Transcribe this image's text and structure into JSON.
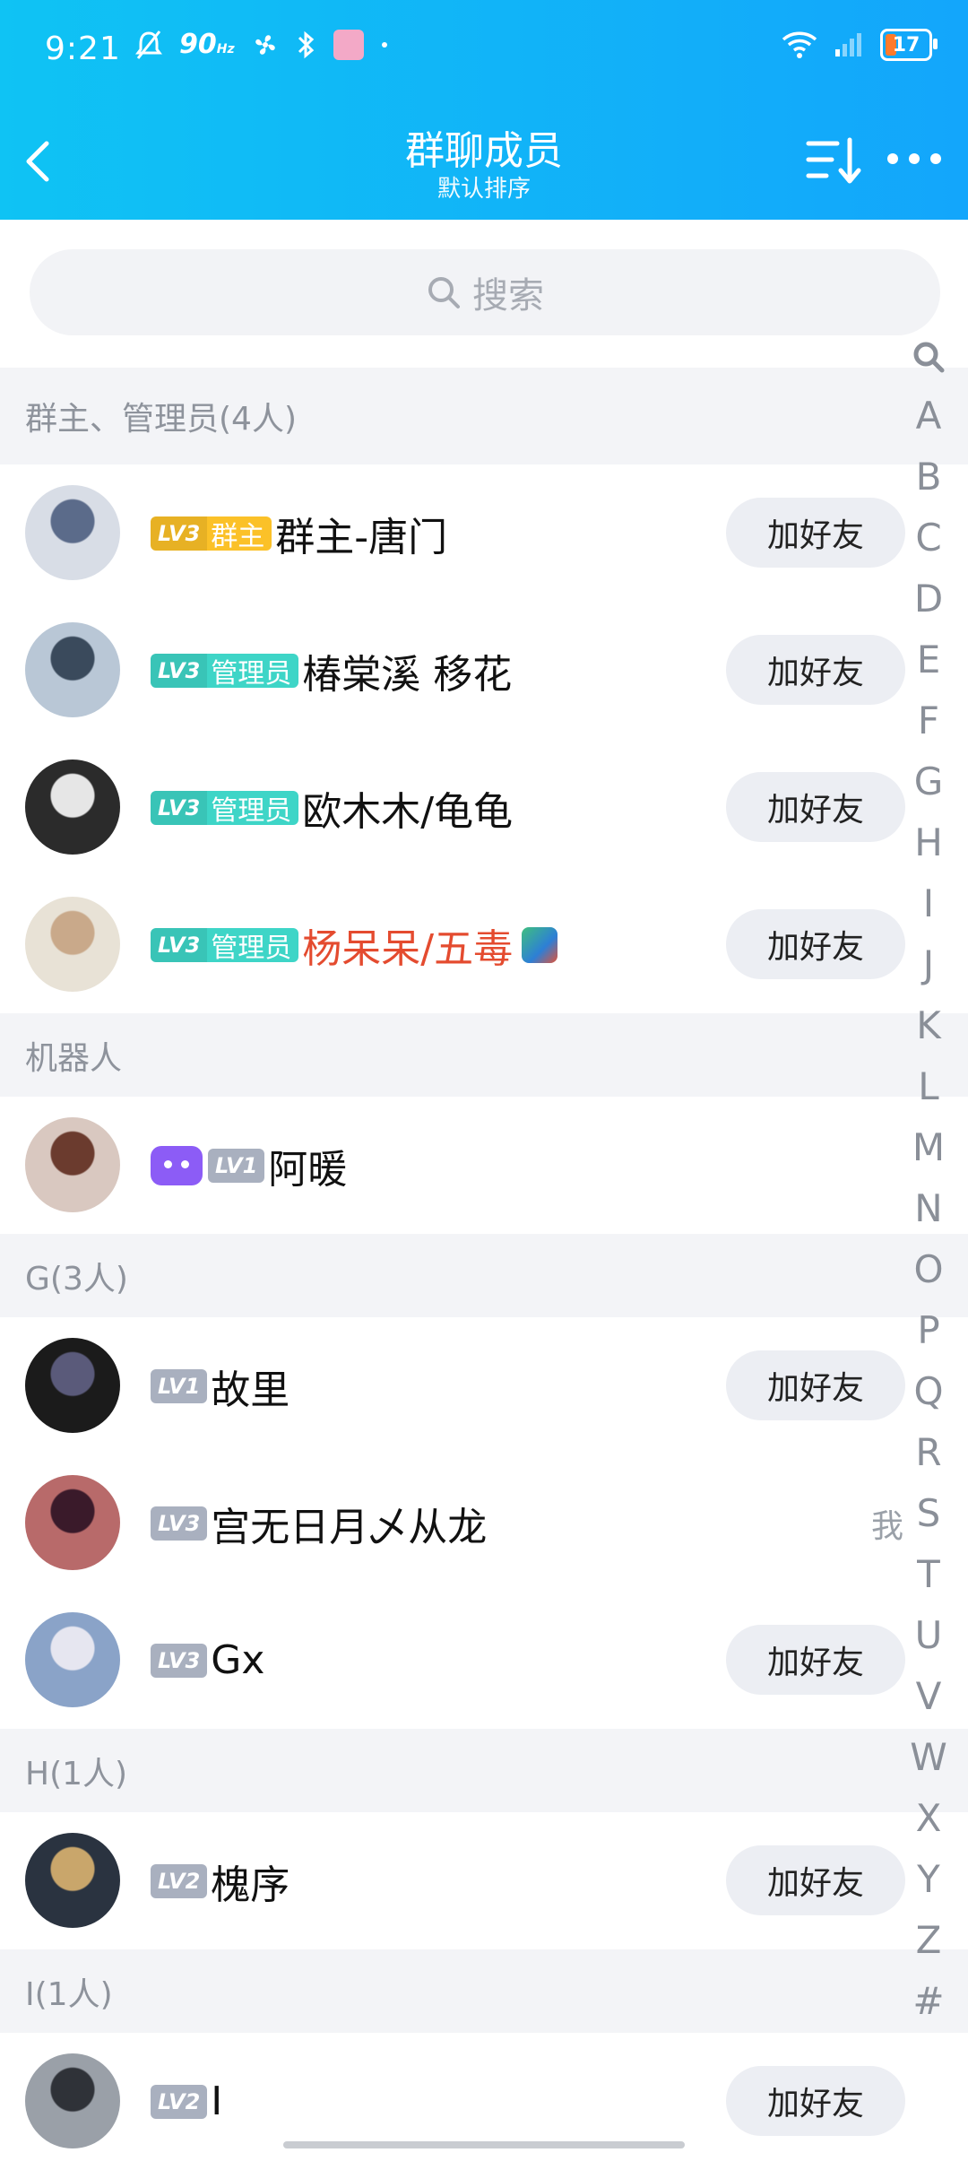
{
  "status_bar": {
    "time": "9:21",
    "refresh_rate": "90",
    "refresh_unit": "Hz",
    "battery": "17"
  },
  "header": {
    "title": "群聊成员",
    "subtitle": "默认排序"
  },
  "search": {
    "placeholder": "搜索"
  },
  "add_friend_label": "加好友",
  "me_label": "我",
  "sections": [
    {
      "title": "群主、管理员(4人)",
      "members": [
        {
          "level": "LV3",
          "role": "群主",
          "name": "群主-唐门",
          "badge_color": "#fbc128",
          "has_add": true
        },
        {
          "level": "LV3",
          "role": "管理员",
          "name": "椿棠溪 移花",
          "badge_color": "#3ed5c7",
          "has_add": true
        },
        {
          "level": "LV3",
          "role": "管理员",
          "name": "欧木木/龟龟",
          "badge_color": "#3ed5c7",
          "has_add": true
        },
        {
          "level": "LV3",
          "role": "管理员",
          "name": "杨呆呆/五毒",
          "badge_color": "#3ed5c7",
          "name_color": "#e44b2f",
          "has_add": true
        }
      ]
    },
    {
      "title": "机器人",
      "members": [
        {
          "level": "LV1",
          "name": "阿暖",
          "is_robot": true,
          "has_add": false
        }
      ]
    },
    {
      "title": "G(3人)",
      "members": [
        {
          "level": "LV1",
          "name": "故里",
          "has_add": true
        },
        {
          "level": "LV3",
          "name": "宫无日月乄从龙",
          "has_add": false,
          "is_me": true
        },
        {
          "level": "LV3",
          "name": "Gx",
          "has_add": true
        }
      ]
    },
    {
      "title": "H(1人)",
      "members": [
        {
          "level": "LV2",
          "name": "槐序",
          "has_add": true
        }
      ]
    },
    {
      "title": "I(1人)",
      "members": [
        {
          "level": "LV2",
          "name": "I",
          "has_add": true
        }
      ]
    }
  ],
  "index_letters": [
    "A",
    "B",
    "C",
    "D",
    "E",
    "F",
    "G",
    "H",
    "I",
    "J",
    "K",
    "L",
    "M",
    "N",
    "O",
    "P",
    "Q",
    "R",
    "S",
    "T",
    "U",
    "V",
    "W",
    "X",
    "Y",
    "Z",
    "#"
  ]
}
